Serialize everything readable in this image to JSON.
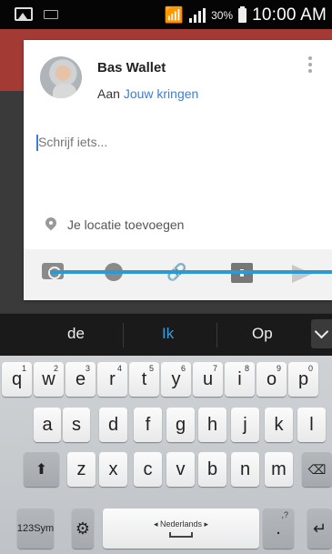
{
  "status_bar": {
    "battery": "30%",
    "time": "10:00 AM",
    "icons": [
      "image-icon",
      "keyboard-icon",
      "wifi-icon",
      "signal-icon",
      "battery-icon"
    ]
  },
  "post_card": {
    "user_name": "Bas Wallet",
    "audience_prefix": "Aan",
    "audience_circles": "Jouw kringen",
    "input_placeholder": "Schrijf iets...",
    "location_label": "Je locatie toevoegen",
    "actions": [
      "camera-icon",
      "emoji-icon",
      "link-icon",
      "event-icon",
      "send-icon"
    ]
  },
  "suggestions": {
    "items": [
      "de",
      "Ik",
      "Op"
    ],
    "highlighted": "Ik"
  },
  "keyboard": {
    "row1": [
      {
        "label": "q",
        "hint": "1"
      },
      {
        "label": "w",
        "hint": "2"
      },
      {
        "label": "e",
        "hint": "3"
      },
      {
        "label": "r",
        "hint": "4"
      },
      {
        "label": "t",
        "hint": "5"
      },
      {
        "label": "y",
        "hint": "6"
      },
      {
        "label": "u",
        "hint": "7"
      },
      {
        "label": "i",
        "hint": "8"
      },
      {
        "label": "o",
        "hint": "9"
      },
      {
        "label": "p",
        "hint": "0"
      }
    ],
    "row2": [
      "a",
      "s",
      "d",
      "f",
      "g",
      "h",
      "j",
      "k",
      "l"
    ],
    "row3": [
      "z",
      "x",
      "c",
      "v",
      "b",
      "n",
      "m"
    ],
    "sym_line1": "123",
    "sym_line2": "Sym",
    "space_label": "◂ Nederlands ▸",
    "period_label": ".",
    "period_hint": ",?"
  },
  "colors": {
    "accent_blue": "#3a7fd6",
    "suggestion_highlight": "#3a9de0",
    "app_header_red": "#a33a34",
    "progress_line": "#2b9ad3"
  }
}
